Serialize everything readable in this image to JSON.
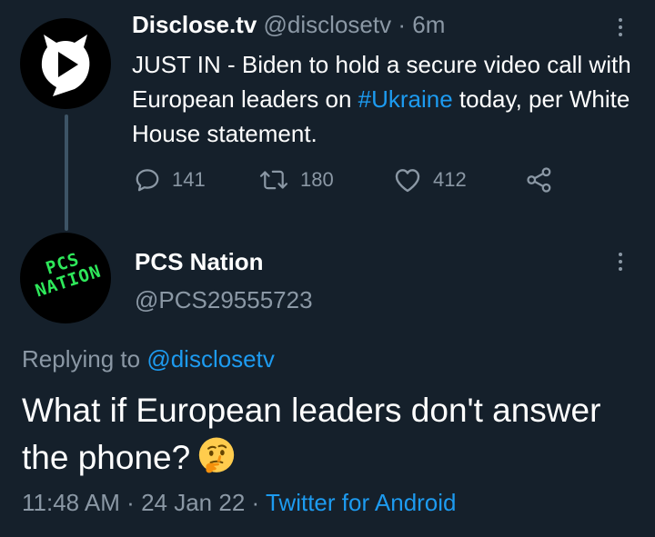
{
  "parent_tweet": {
    "display_name": "Disclose.tv",
    "handle": "@disclosetv",
    "separator": "·",
    "time": "6m",
    "text_before": "JUST IN - Biden to hold a secure video call with European leaders on ",
    "hashtag": "#Ukraine",
    "text_after": " today, per White House statement.",
    "reply_count": "141",
    "retweet_count": "180",
    "like_count": "412"
  },
  "reply": {
    "display_name": "PCS Nation",
    "handle": "@PCS29555723",
    "avatar_text_line1": "PCS",
    "avatar_text_line2": "NATION",
    "replying_to_prefix": "Replying to ",
    "replying_to_handle": "@disclosetv",
    "text": "What if European leaders don't answer the phone?",
    "emoji": "thinking-face",
    "time": "11:48 AM",
    "separator1": "·",
    "date": "24 Jan 22",
    "separator2": "·",
    "source": "Twitter for Android"
  },
  "colors": {
    "background": "#15202b",
    "text": "#ffffff",
    "muted": "#8b98a5",
    "accent": "#1d9bf0",
    "pcs_green": "#2ee85a"
  }
}
